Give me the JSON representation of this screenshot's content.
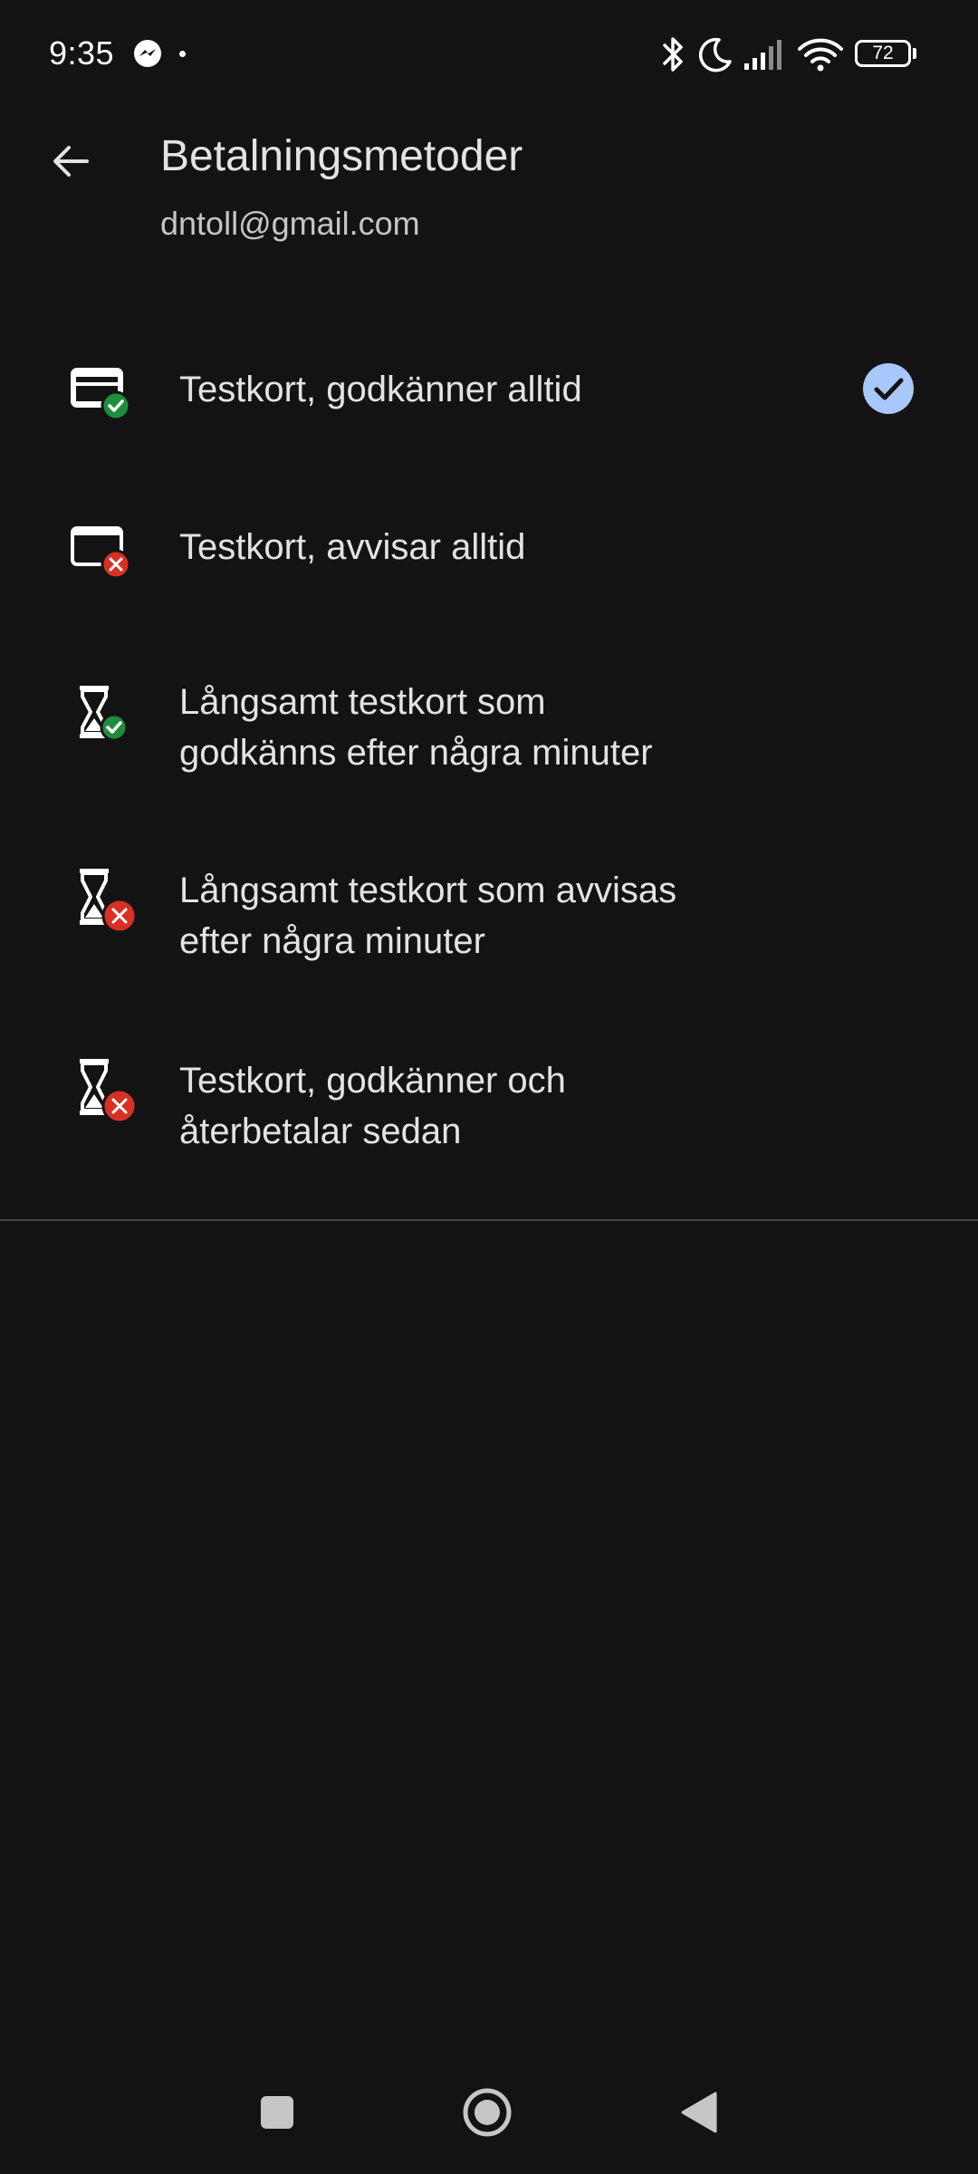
{
  "status_bar": {
    "time": "9:35",
    "battery_level": "72",
    "icons": [
      "messenger-icon",
      "bluetooth-icon",
      "moon-icon",
      "signal-icon",
      "wifi-icon",
      "battery-icon"
    ]
  },
  "app_bar": {
    "title": "Betalningsmetoder",
    "subtitle": "dntoll@gmail.com",
    "back_icon": "arrow-back-icon"
  },
  "payment_methods": [
    {
      "label_lines": [
        "Testkort, godkänner alltid"
      ],
      "icon": "card-approved-icon",
      "selected": true
    },
    {
      "label_lines": [
        "Testkort, avvisar alltid"
      ],
      "icon": "card-declined-icon",
      "selected": false
    },
    {
      "label_lines": [
        "Långsamt testkort som",
        "godkänns efter några minuter"
      ],
      "icon": "hourglass-approved-icon",
      "selected": false
    },
    {
      "label_lines": [
        "Långsamt testkort som avvisas",
        "efter några minuter"
      ],
      "icon": "hourglass-declined-icon",
      "selected": false
    },
    {
      "label_lines": [
        "Testkort, godkänner och",
        "återbetalar sedan"
      ],
      "icon": "hourglass-declined-icon",
      "selected": false
    }
  ],
  "colors": {
    "background": "#131314",
    "approved_badge": "#1e8e3e",
    "declined_badge": "#d93025",
    "selected_check": "#a8c7fa",
    "divider": "#444746"
  },
  "nav_bar": {
    "icons": [
      "recents-square-icon",
      "home-circle-icon",
      "back-triangle-icon"
    ]
  }
}
